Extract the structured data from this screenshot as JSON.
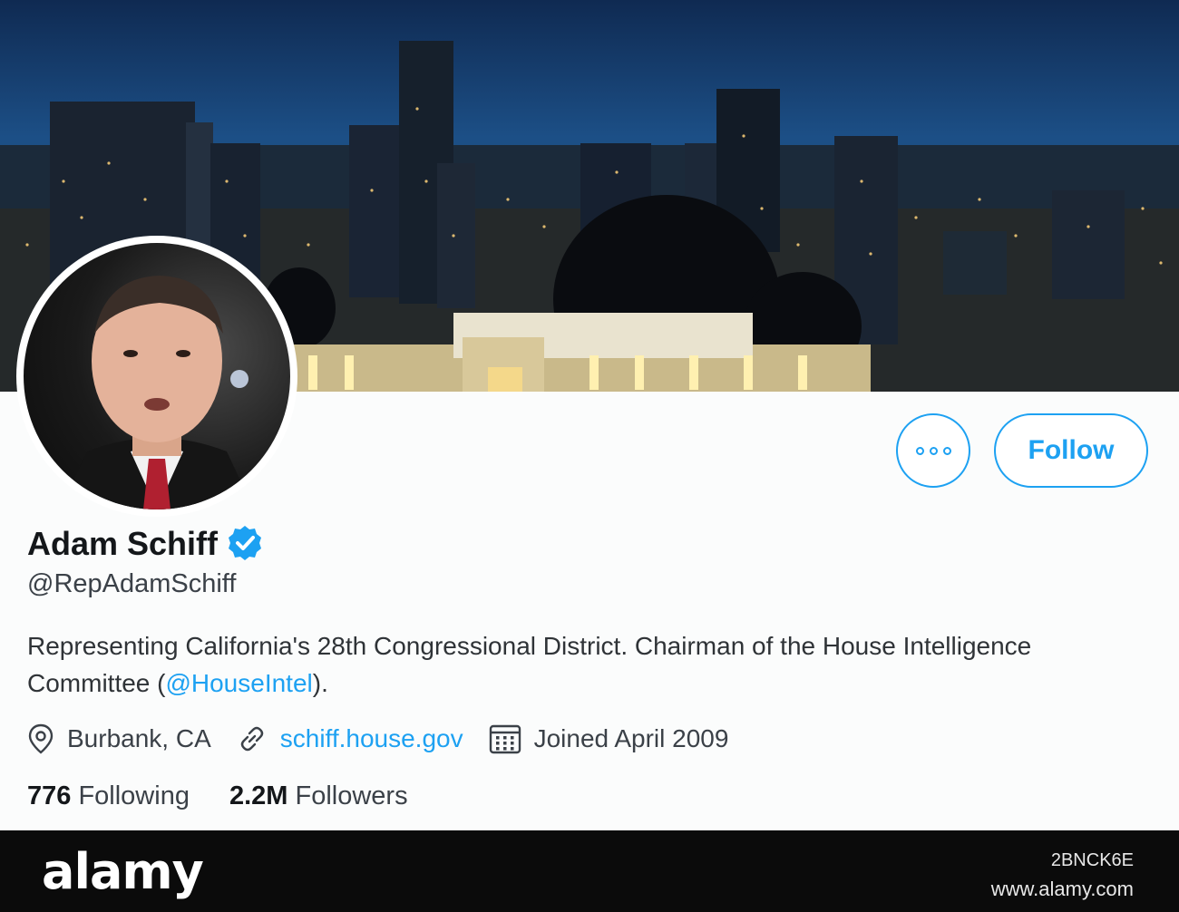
{
  "profile": {
    "name": "Adam Schiff",
    "handle": "@RepAdamSchiff",
    "bio_text": "Representing California's 28th Congressional District. Chairman of the House Intelligence Committee (",
    "bio_mention": "@HouseIntel",
    "bio_end": ").",
    "location": "Burbank, CA",
    "website": "schiff.house.gov",
    "joined": "Joined April 2009",
    "following_count": "776",
    "following_label": "Following",
    "followers_count": "2.2M",
    "followers_label": "Followers"
  },
  "actions": {
    "follow_label": "Follow"
  },
  "icons": {
    "more": "more-horizontal-icon",
    "verified": "verified-badge-icon",
    "location": "location-pin-icon",
    "link": "link-icon",
    "calendar": "calendar-icon"
  },
  "watermark": {
    "logo": "alamy",
    "image_code": "2BNCK6E",
    "site": "www.alamy.com"
  },
  "colors": {
    "accent": "#1da1f2",
    "text_primary": "#14171a",
    "text_secondary": "#3b4148"
  }
}
